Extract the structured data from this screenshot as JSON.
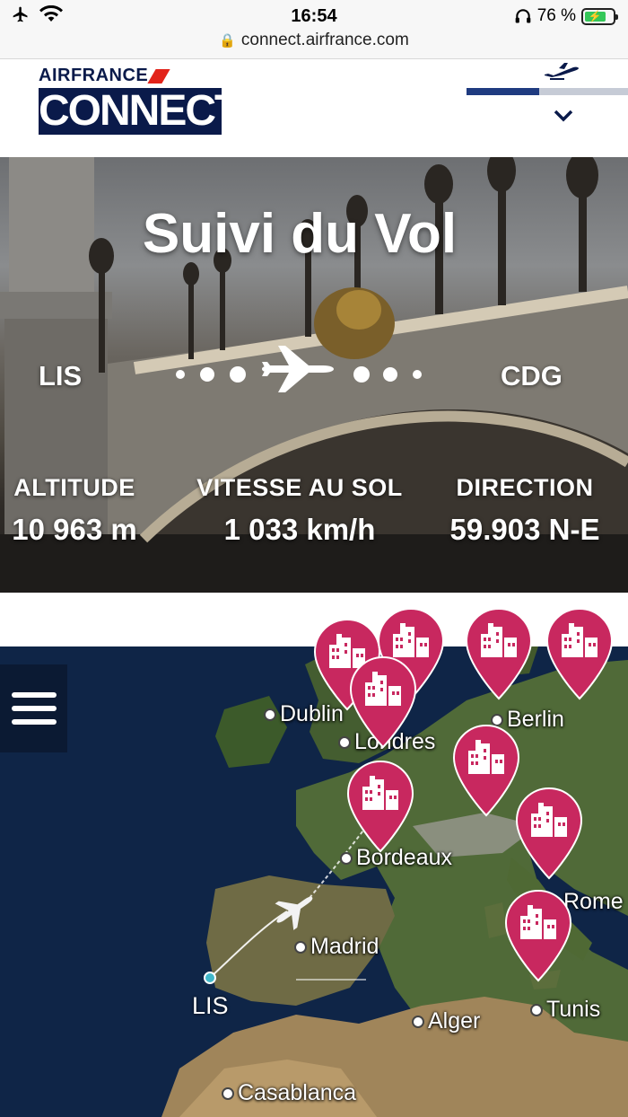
{
  "status_bar": {
    "time": "16:54",
    "battery_text": "76 %",
    "battery_level": 0.76,
    "icons": [
      "airplane-mode-icon",
      "wifi-icon",
      "headphones-icon",
      "battery-icon"
    ]
  },
  "browser": {
    "url": "connect.airfrance.com"
  },
  "header": {
    "logo_top": "AIRFRANCE",
    "logo_bottom": "CONNECT",
    "flight_progress": 0.45
  },
  "hero": {
    "title": "Suivi du Vol",
    "origin": "LIS",
    "destination": "CDG",
    "stats": [
      {
        "label": "ALTITUDE",
        "value": "10 963 m"
      },
      {
        "label": "VITESSE AU SOL",
        "value": "1 033 km/h"
      },
      {
        "label": "DIRECTION",
        "value": "59.903 N-E"
      }
    ]
  },
  "map": {
    "cities": [
      "Dublin",
      "Londres",
      "Berlin",
      "Bordeaux",
      "Rome",
      "Madrid",
      "Alger",
      "Tunis",
      "Casablanca"
    ],
    "origin_label": "LIS",
    "colors": {
      "pin": "#c8285f",
      "sea": "#0e2244",
      "route": "#ffffff",
      "origin_marker": "#41b7c9"
    }
  }
}
